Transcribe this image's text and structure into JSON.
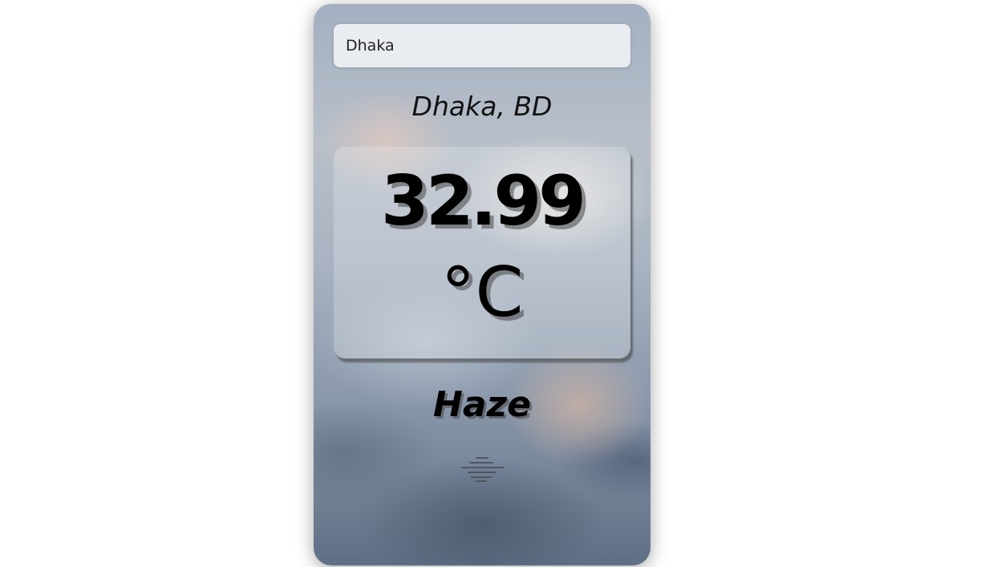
{
  "search": {
    "value": "Dhaka"
  },
  "weather": {
    "location": "Dhaka, BD",
    "temperature": "32.99",
    "unit": "°C",
    "condition": "Haze",
    "icon": "haze-icon"
  }
}
